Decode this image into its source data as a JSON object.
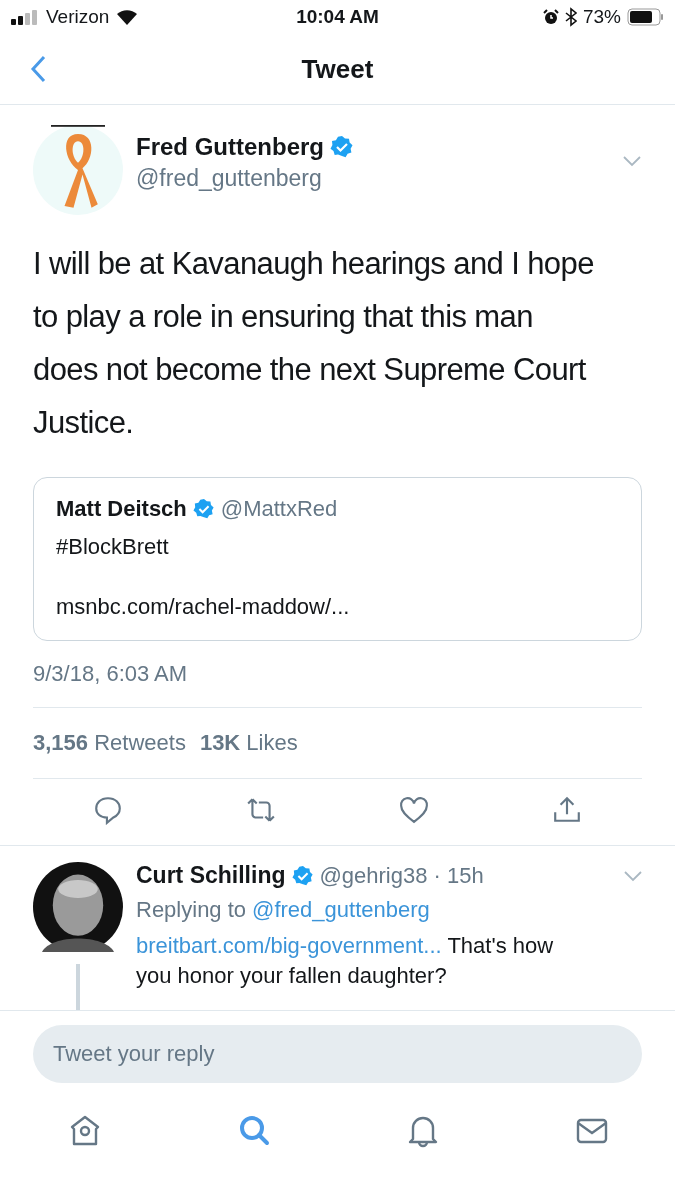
{
  "status_bar": {
    "carrier": "Verizon",
    "time": "10:04 AM",
    "battery": "73%"
  },
  "nav": {
    "title": "Tweet"
  },
  "tweet": {
    "name": "Fred Guttenberg",
    "verified": true,
    "handle": "@fred_guttenberg",
    "text": "I will be at Kavanaugh hearings and I hope to play a role in ensuring that this man does not become the next Supreme Court Justice.",
    "quote": {
      "name": "Matt Deitsch",
      "verified": true,
      "handle": "@MattxRed",
      "text": "#BlockBrett",
      "link": "msnbc.com/rachel-maddow/..."
    },
    "timestamp": "9/3/18, 6:03 AM",
    "stats": [
      {
        "count": "3,156",
        "label": "Retweets"
      },
      {
        "count": "13K",
        "label": "Likes"
      }
    ],
    "actions": [
      {
        "kind": "reply"
      },
      {
        "kind": "retweet"
      },
      {
        "kind": "like"
      },
      {
        "kind": "share"
      }
    ]
  },
  "reply": {
    "name": "Curt Schilling",
    "verified": true,
    "handle": "@gehrig38",
    "time": "· 15h",
    "replying_label": "Replying to",
    "replying_to": "@fred_guttenberg",
    "link": "breitbart.com/big-government...",
    "text": "That's how you honor your fallen daughter?"
  },
  "composer": {
    "placeholder": "Tweet your reply"
  },
  "tab_bar": [
    {
      "kind": "home",
      "selected": false
    },
    {
      "kind": "search",
      "selected": true
    },
    {
      "kind": "notifications",
      "selected": false
    },
    {
      "kind": "messages",
      "selected": false
    }
  ]
}
